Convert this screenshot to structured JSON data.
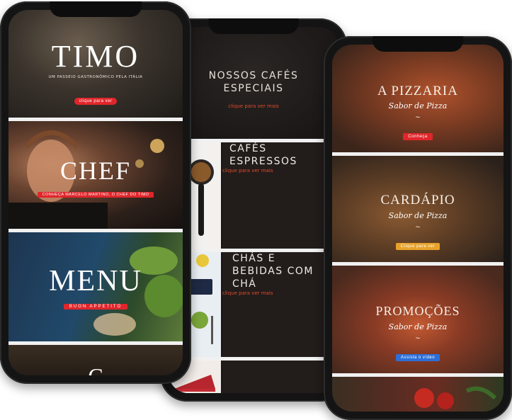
{
  "phone1": {
    "timo": {
      "title": "TIMO",
      "subtitle": "UM PASSEIO GASTRONÔMICO PELA ITÁLIA",
      "button": "clique para ver"
    },
    "chef": {
      "title": "CHEF",
      "subtitle": "CONHEÇA MARCELO MARTINO, O CHEF DO TIMO"
    },
    "menu": {
      "title": "MENU",
      "subtitle": "BUON APPETITO"
    },
    "partial": {
      "title": "C"
    }
  },
  "phone2": {
    "top": {
      "title": "NOSSOS CAFÉS ESPECIAIS",
      "link": "clique para ver mais"
    },
    "espressos": {
      "title": "CAFÉS ESPRESSOS",
      "link": "clique para ver mais"
    },
    "chas": {
      "title": "CHÁS E BEBIDAS COM CHÁ",
      "link": "clique para ver mais"
    }
  },
  "phone3": {
    "pizzaria": {
      "title": "A PIZZARIA",
      "script": "Sabor de Pizza",
      "tilde": "~",
      "button": "Conheça"
    },
    "cardapio": {
      "title": "CARDÁPIO",
      "script": "Sabor de Pizza",
      "tilde": "~",
      "button": "Clique para ver"
    },
    "promocoes": {
      "title": "PROMOÇÕES",
      "script": "Sabor de Pizza",
      "tilde": "~",
      "button": "Assista o vídeo"
    }
  },
  "colors": {
    "red": "#e0262b",
    "orange": "#e8a22a",
    "blue": "#2d6fd8",
    "coral": "#e34b2c"
  }
}
